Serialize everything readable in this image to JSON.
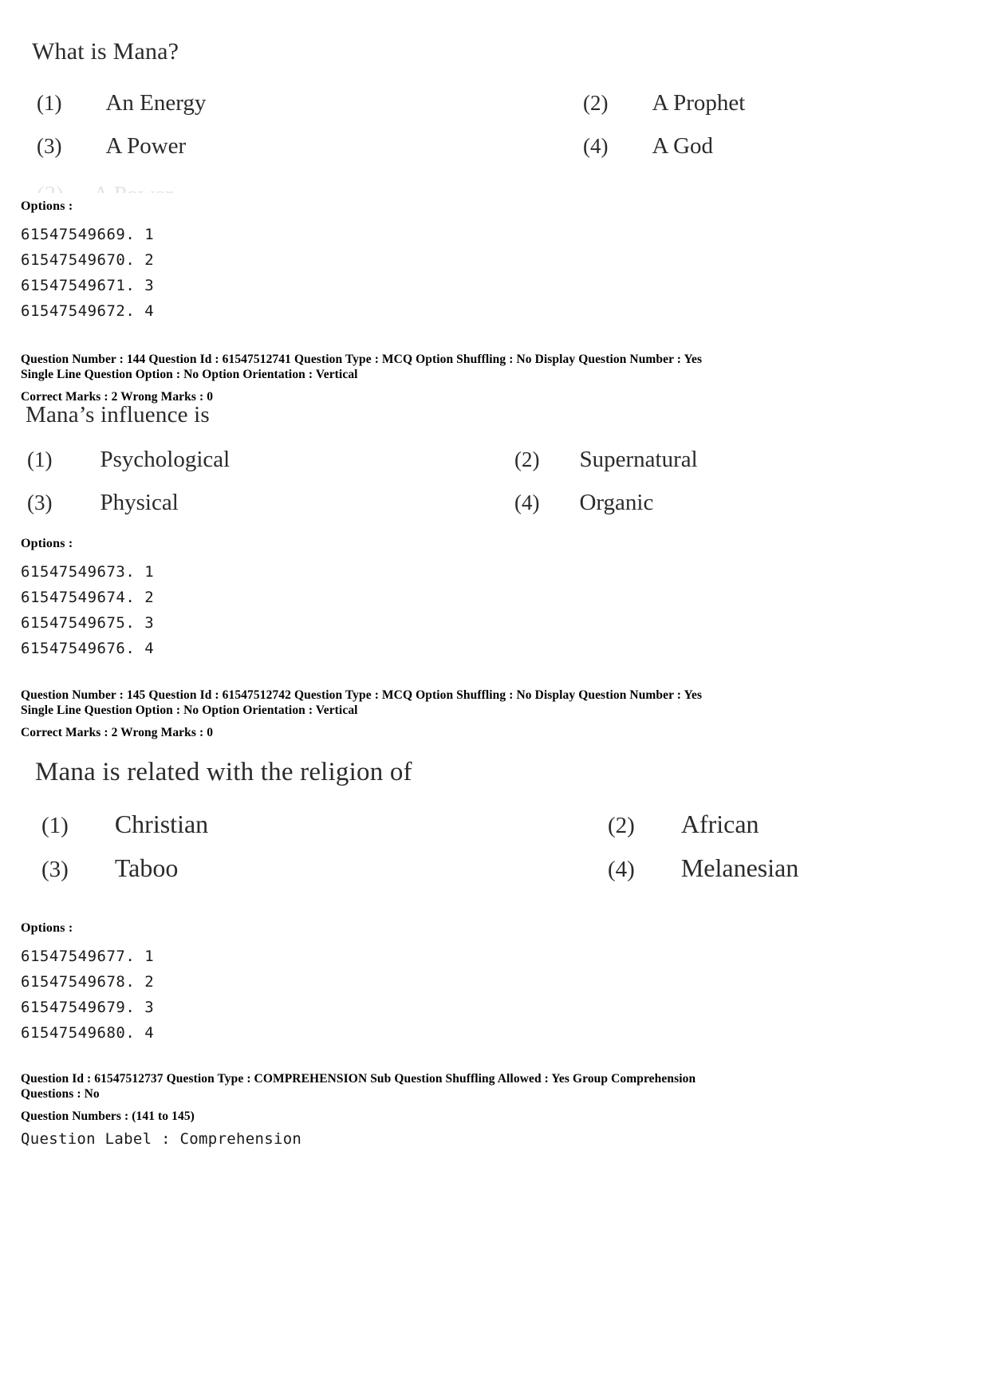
{
  "document": {
    "kind": "exam-answer-key-page",
    "options_label": "Options :"
  },
  "questions": [
    {
      "stem": "What is Mana?",
      "options": [
        {
          "num": "(1)",
          "text": "An Energy"
        },
        {
          "num": "(2)",
          "text": "A Prophet"
        },
        {
          "num": "(3)",
          "text": "A Power"
        },
        {
          "num": "(4)",
          "text": "A God"
        }
      ],
      "option_ids": [
        "61547549669. 1",
        "61547549670. 2",
        "61547549671. 3",
        "61547549672. 4"
      ],
      "meta": {
        "line1": "Question Number : 144  Question Id : 61547512741  Question Type : MCQ  Option Shuffling : No  Display Question Number : Yes",
        "line2": "Single Line Question Option : No  Option Orientation : Vertical",
        "line3": "Correct Marks : 2  Wrong Marks : 0"
      }
    },
    {
      "stem": "Mana’s influence is",
      "options": [
        {
          "num": "(1)",
          "text": "Psychological"
        },
        {
          "num": "(2)",
          "text": "Supernatural"
        },
        {
          "num": "(3)",
          "text": "Physical"
        },
        {
          "num": "(4)",
          "text": "Organic"
        }
      ],
      "option_ids": [
        "61547549673. 1",
        "61547549674. 2",
        "61547549675. 3",
        "61547549676. 4"
      ],
      "meta": {
        "line1": "Question Number : 145  Question Id : 61547512742  Question Type : MCQ  Option Shuffling : No  Display Question Number : Yes",
        "line2": "Single Line Question Option : No  Option Orientation : Vertical",
        "line3": "Correct Marks : 2  Wrong Marks : 0"
      }
    },
    {
      "stem": "Mana is related with the religion of",
      "options": [
        {
          "num": "(1)",
          "text": "Christian"
        },
        {
          "num": "(2)",
          "text": "African"
        },
        {
          "num": "(3)",
          "text": "Taboo"
        },
        {
          "num": "(4)",
          "text": "Melanesian"
        }
      ],
      "option_ids": [
        "61547549677. 1",
        "61547549678. 2",
        "61547549679. 3",
        "61547549680. 4"
      ]
    }
  ],
  "comprehension": {
    "line1": "Question Id : 61547512737  Question Type : COMPREHENSION  Sub Question Shuffling Allowed : Yes  Group Comprehension",
    "line2": "Questions : No",
    "line3": "Question Numbers : (141 to 145)",
    "label": "Question Label : Comprehension"
  }
}
